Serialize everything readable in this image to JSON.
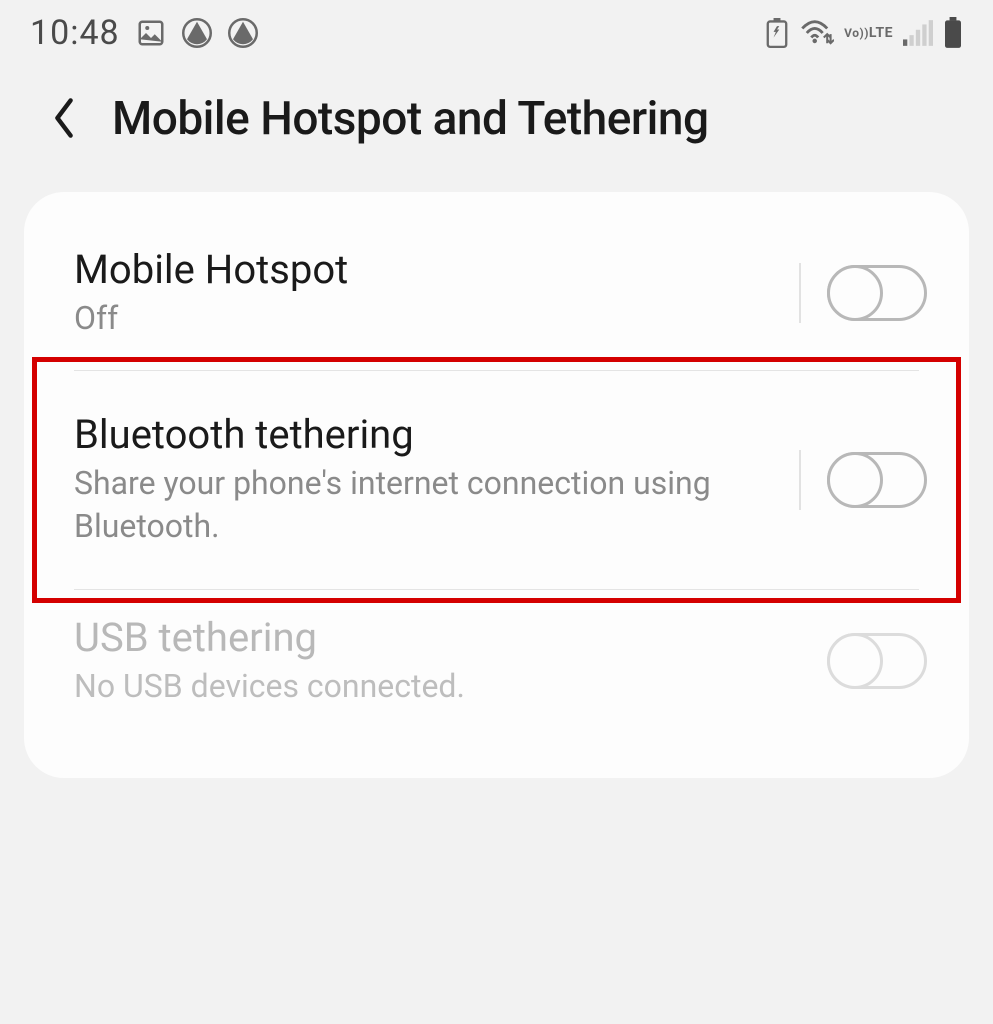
{
  "status_bar": {
    "time": "10:48",
    "left_icons": [
      "image",
      "avast",
      "avast"
    ],
    "right_icons": [
      "recycle-battery",
      "wifi-updown",
      "volte",
      "signal",
      "battery"
    ]
  },
  "header": {
    "title": "Mobile Hotspot and Tethering"
  },
  "rows": {
    "hotspot": {
      "title": "Mobile Hotspot",
      "subtitle": "Off",
      "toggled": false,
      "enabled": true
    },
    "bluetooth": {
      "title": "Bluetooth tethering",
      "subtitle": "Share your phone's internet connection using Bluetooth.",
      "toggled": false,
      "enabled": true,
      "highlighted": true
    },
    "usb": {
      "title": "USB tethering",
      "subtitle": "No USB devices connected.",
      "toggled": false,
      "enabled": false
    }
  }
}
